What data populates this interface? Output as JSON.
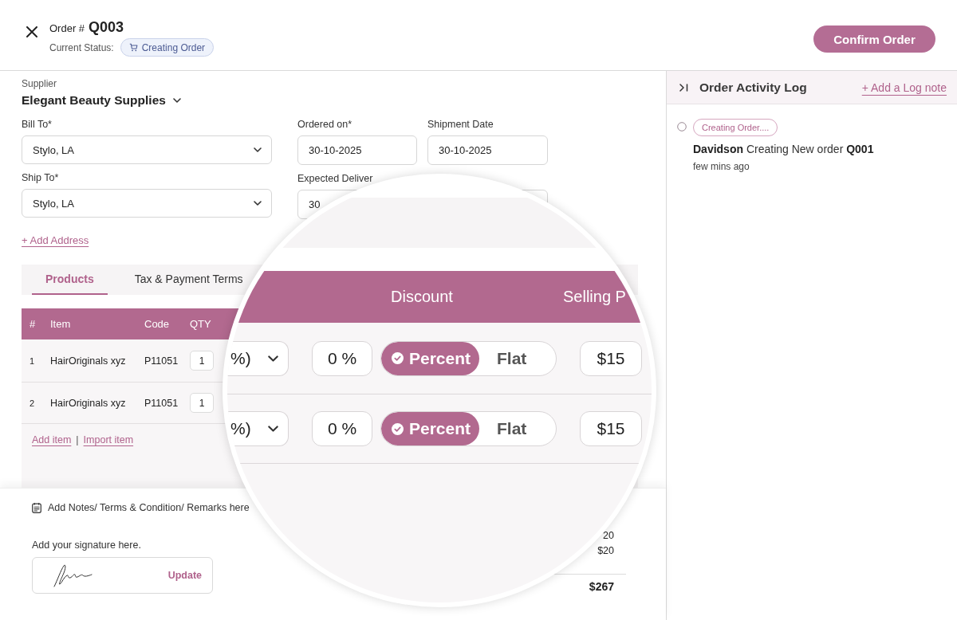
{
  "header": {
    "order_label": "Order #",
    "order_number": "Q003",
    "status_label": "Current Status:",
    "status": "Creating Order",
    "confirm_button": "Confirm Order"
  },
  "supplier": {
    "label": "Supplier",
    "name": "Elegant Beauty Supplies"
  },
  "addresses": [
    {
      "label": "Bill To*",
      "value": "Stylo, LA"
    },
    {
      "label": "Ship To*",
      "value": "Stylo, LA"
    }
  ],
  "add_address": "+ Add Address",
  "dates": [
    {
      "label": "Ordered on*",
      "value": "30-10-2025"
    },
    {
      "label": "Shipment Date",
      "value": "30-10-2025"
    },
    {
      "label": "Expected Deliver",
      "value": "30"
    }
  ],
  "tabs": [
    {
      "label": "Products",
      "selected": true
    },
    {
      "label": "Tax & Payment Terms",
      "selected": false
    }
  ],
  "table": {
    "columns": [
      "#",
      "Item",
      "Code",
      "QTY"
    ],
    "rows": [
      {
        "number": "1",
        "item": "HairOriginals xyz",
        "code": "P11051",
        "qty": "1"
      },
      {
        "number": "2",
        "item": "HairOriginals xyz",
        "code": "P11051",
        "qty": "1"
      }
    ]
  },
  "table_links": {
    "add": "Add item",
    "separator": "|",
    "import": "Import item"
  },
  "notes": "Add Notes/ Terms & Condition/ Remarks here",
  "signature": {
    "label": "Add your signature here.",
    "action": "Update"
  },
  "totals": {
    "amounts": [
      "20",
      "$20"
    ],
    "grand_total": "$267"
  },
  "magnifier": {
    "columns": [
      "Discount",
      "Selling P"
    ],
    "rows": [
      {
        "unit": "%)",
        "discount": "0 %",
        "modes": [
          {
            "label": "Percent",
            "selected": true
          },
          {
            "label": "Flat",
            "selected": false
          }
        ],
        "selling_price": "$15"
      },
      {
        "unit": "%)",
        "discount": "0 %",
        "modes": [
          {
            "label": "Percent",
            "selected": true
          },
          {
            "label": "Flat",
            "selected": false
          }
        ],
        "selling_price": "$15"
      }
    ]
  },
  "activity_log": {
    "title": "Order Activity Log",
    "add_note": "+ Add a Log note",
    "entries": [
      {
        "tag": "Creating Order....",
        "text": "**Davidson** Creating New order **Q001**",
        "time": "few mins ago"
      }
    ]
  }
}
